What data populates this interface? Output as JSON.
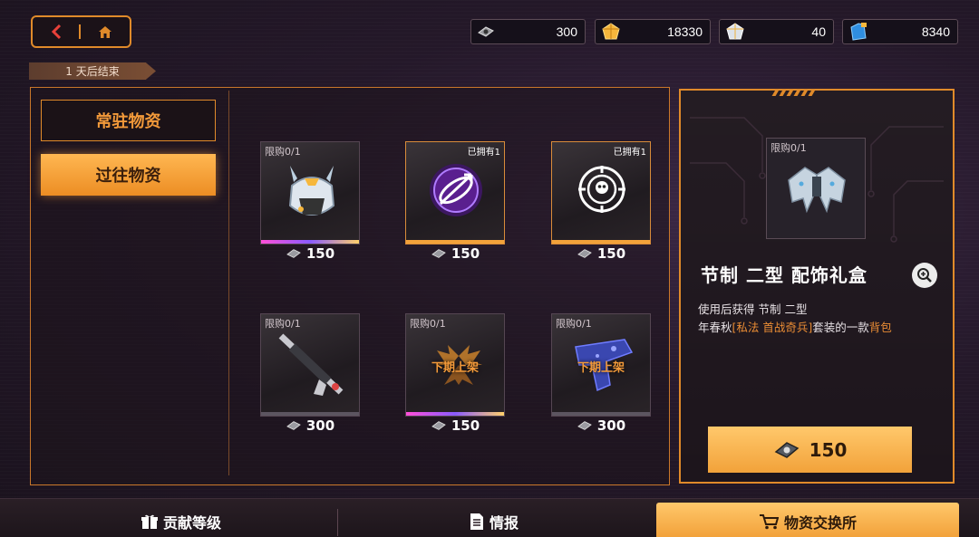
{
  "colors": {
    "accent": "#e08a2a",
    "highlight": "#e98c34",
    "panel_bg": "#1d151c"
  },
  "nav": {
    "back_icon": "chevron-left-icon",
    "home_icon": "home-icon"
  },
  "currencies": [
    {
      "icon": "exchange-token-icon",
      "value": "300"
    },
    {
      "icon": "gold-gem-icon",
      "value": "18330"
    },
    {
      "icon": "silver-gem-icon",
      "value": "40"
    },
    {
      "icon": "blue-ticket-icon",
      "value": "8340"
    }
  ],
  "timer": {
    "text": "1 天后结束"
  },
  "tabs": [
    {
      "label": "常驻物资",
      "active": false
    },
    {
      "label": "过往物资",
      "active": true
    }
  ],
  "items": [
    {
      "limit": "限购0/1",
      "owned": "",
      "price": "150",
      "status": "",
      "icon": "helmet-mask-icon",
      "rarity": "legendary"
    },
    {
      "limit": "",
      "owned": "已拥有1",
      "price": "150",
      "status": "",
      "icon": "arrow-emblem-icon",
      "rarity": "epic"
    },
    {
      "limit": "",
      "owned": "已拥有1",
      "price": "150",
      "status": "",
      "icon": "skull-target-icon",
      "rarity": "epic"
    },
    {
      "limit": "限购0/1",
      "owned": "",
      "price": "300",
      "status": "",
      "icon": "rifle-icon",
      "rarity": "common"
    },
    {
      "limit": "限购0/1",
      "owned": "",
      "price": "150",
      "status": "下期上架",
      "icon": "bat-wings-icon",
      "rarity": "legendary"
    },
    {
      "limit": "限购0/1",
      "owned": "",
      "price": "300",
      "status": "下期上架",
      "icon": "blue-pistol-icon",
      "rarity": "common"
    }
  ],
  "detail": {
    "limit": "限购0/1",
    "title": "节制 二型 配饰礼盒",
    "desc_line1": "使用后获得 节制 二型",
    "desc_line2_a": "年春秋",
    "desc_line2_b": "[私法 首战奇兵]",
    "desc_line2_c": "套装的一款",
    "desc_line2_d": "背包",
    "price": "150",
    "image_icon": "mech-wings-backpack-icon",
    "zoom_icon": "zoom-in-icon"
  },
  "bottom_tabs": [
    {
      "label": "贡献等级",
      "icon": "gift-icon"
    },
    {
      "label": "情报",
      "icon": "document-icon"
    },
    {
      "label": "物资交换所",
      "icon": "cart-icon"
    }
  ]
}
